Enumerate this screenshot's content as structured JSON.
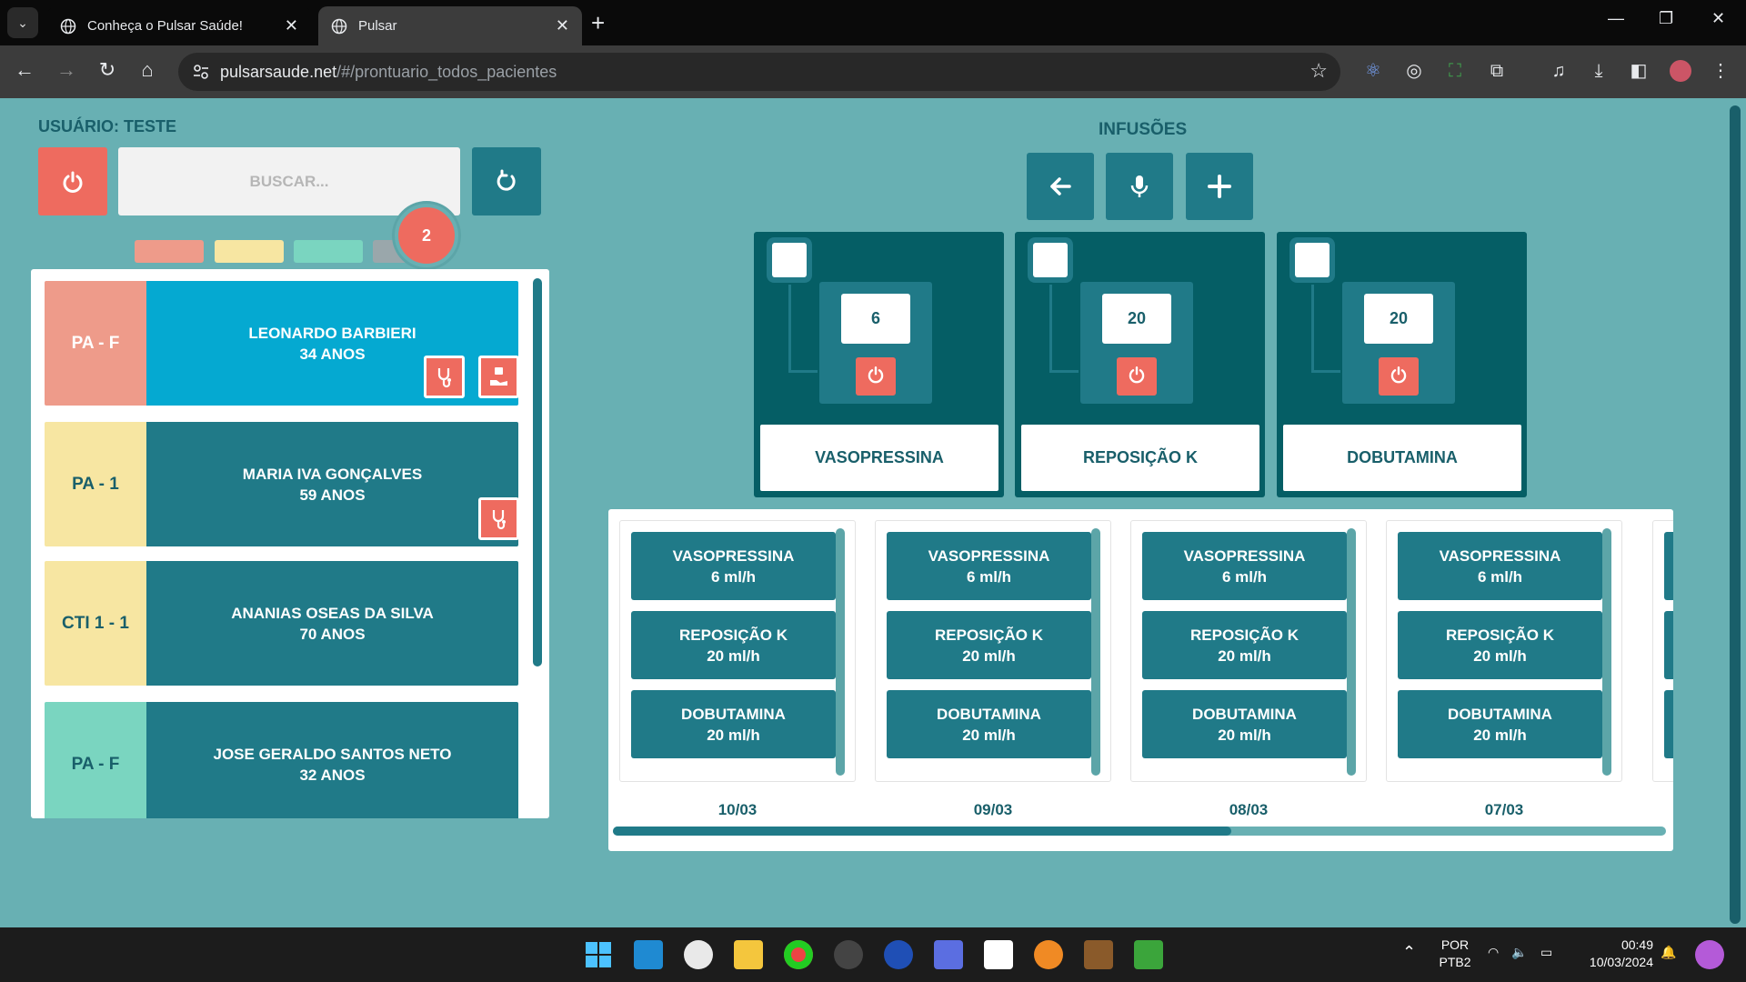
{
  "browser": {
    "tabs": [
      {
        "title": "Conheça o Pulsar Saúde!"
      },
      {
        "title": "Pulsar"
      }
    ],
    "url_host": "pulsarsaude.net",
    "url_path": "/#/prontuario_todos_pacientes"
  },
  "page": {
    "user_label": "USUÁRIO: TESTE",
    "search_placeholder": "BUSCAR...",
    "badge_count": "2",
    "filter_colors": [
      "#ee9b8a",
      "#f7e6a2",
      "#7ad5c0",
      "#9aa7ab"
    ],
    "patients": [
      {
        "location": "PA - F",
        "name": "LEONARDO BARBIERI",
        "age": "34 ANOS",
        "loc_color": "#ee9b8a",
        "info_color": "#05a9d1"
      },
      {
        "location": "PA - 1",
        "name": "MARIA IVA GONÇALVES",
        "age": "59 ANOS",
        "loc_color": "#f7e6a2",
        "info_color": "#207a88"
      },
      {
        "location": "CTI 1 - 1",
        "name": "ANANIAS OSEAS DA SILVA",
        "age": "70 ANOS",
        "loc_color": "#f7e6a2",
        "info_color": "#207a88"
      },
      {
        "location": "PA - F",
        "name": "JOSE GERALDO SANTOS NETO",
        "age": "32 ANOS",
        "loc_color": "#7ad5c0",
        "info_color": "#207a88"
      }
    ],
    "infusions_title": "INFUSÕES",
    "pumps": [
      {
        "value": "6",
        "name": "VASOPRESSINA"
      },
      {
        "value": "20",
        "name": "REPOSIÇÃO K"
      },
      {
        "value": "20",
        "name": "DOBUTAMINA"
      }
    ],
    "history": [
      {
        "date": "10/03",
        "entries": [
          {
            "drug": "VASOPRESSINA",
            "rate": "6 ml/h"
          },
          {
            "drug": "REPOSIÇÃO K",
            "rate": "20 ml/h"
          },
          {
            "drug": "DOBUTAMINA",
            "rate": "20 ml/h"
          }
        ]
      },
      {
        "date": "09/03",
        "entries": [
          {
            "drug": "VASOPRESSINA",
            "rate": "6 ml/h"
          },
          {
            "drug": "REPOSIÇÃO K",
            "rate": "20 ml/h"
          },
          {
            "drug": "DOBUTAMINA",
            "rate": "20 ml/h"
          }
        ]
      },
      {
        "date": "08/03",
        "entries": [
          {
            "drug": "VASOPRESSINA",
            "rate": "6 ml/h"
          },
          {
            "drug": "REPOSIÇÃO K",
            "rate": "20 ml/h"
          },
          {
            "drug": "DOBUTAMINA",
            "rate": "20 ml/h"
          }
        ]
      },
      {
        "date": "07/03",
        "entries": [
          {
            "drug": "VASOPRESSINA",
            "rate": "6 ml/h"
          },
          {
            "drug": "REPOSIÇÃO K",
            "rate": "20 ml/h"
          },
          {
            "drug": "DOBUTAMINA",
            "rate": "20 ml/h"
          }
        ]
      }
    ]
  },
  "taskbar": {
    "lang": "POR",
    "layout": "PTB2",
    "time": "00:49",
    "date": "10/03/2024"
  },
  "colors": {
    "page_bg": "#68b0b3",
    "accent_red": "#ee6b5f",
    "teal": "#207a88",
    "dark_teal": "#055e65",
    "title_text": "#195f6a"
  }
}
